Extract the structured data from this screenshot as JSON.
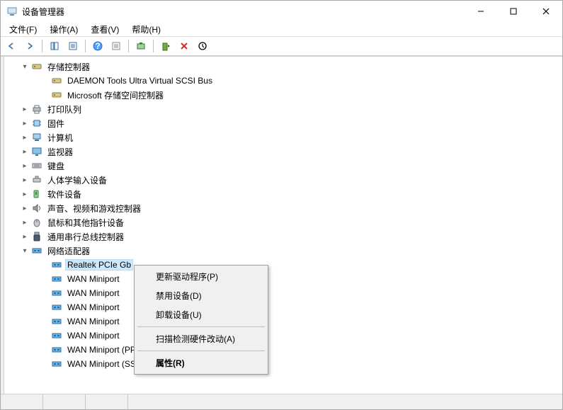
{
  "window": {
    "title": "设备管理器"
  },
  "menu": {
    "file": "文件(F)",
    "action": "操作(A)",
    "view": "查看(V)",
    "help": "帮助(H)"
  },
  "tree": {
    "storage_controllers": "存储控制器",
    "storage_children": [
      "DAEMON Tools Ultra Virtual SCSI Bus",
      "Microsoft 存储空间控制器"
    ],
    "print_queue": "打印队列",
    "firmware": "固件",
    "computer": "计算机",
    "monitor": "监视器",
    "keyboard": "键盘",
    "hid": "人体学输入设备",
    "software_devices": "软件设备",
    "sound": "声音、视频和游戏控制器",
    "mouse": "鼠标和其他指针设备",
    "usb": "通用串行总线控制器",
    "network_adapters": "网络适配器",
    "network_children": [
      "Realtek PCIe Gb",
      "WAN Miniport",
      "WAN Miniport",
      "WAN Miniport",
      "WAN Miniport",
      "WAN Miniport",
      "WAN Miniport (PPTP)",
      "WAN Miniport (SSTP)"
    ]
  },
  "context_menu": {
    "update_driver": "更新驱动程序(P)",
    "disable_device": "禁用设备(D)",
    "uninstall_device": "卸载设备(U)",
    "scan_changes": "扫描检测硬件改动(A)",
    "properties": "属性(R)"
  }
}
